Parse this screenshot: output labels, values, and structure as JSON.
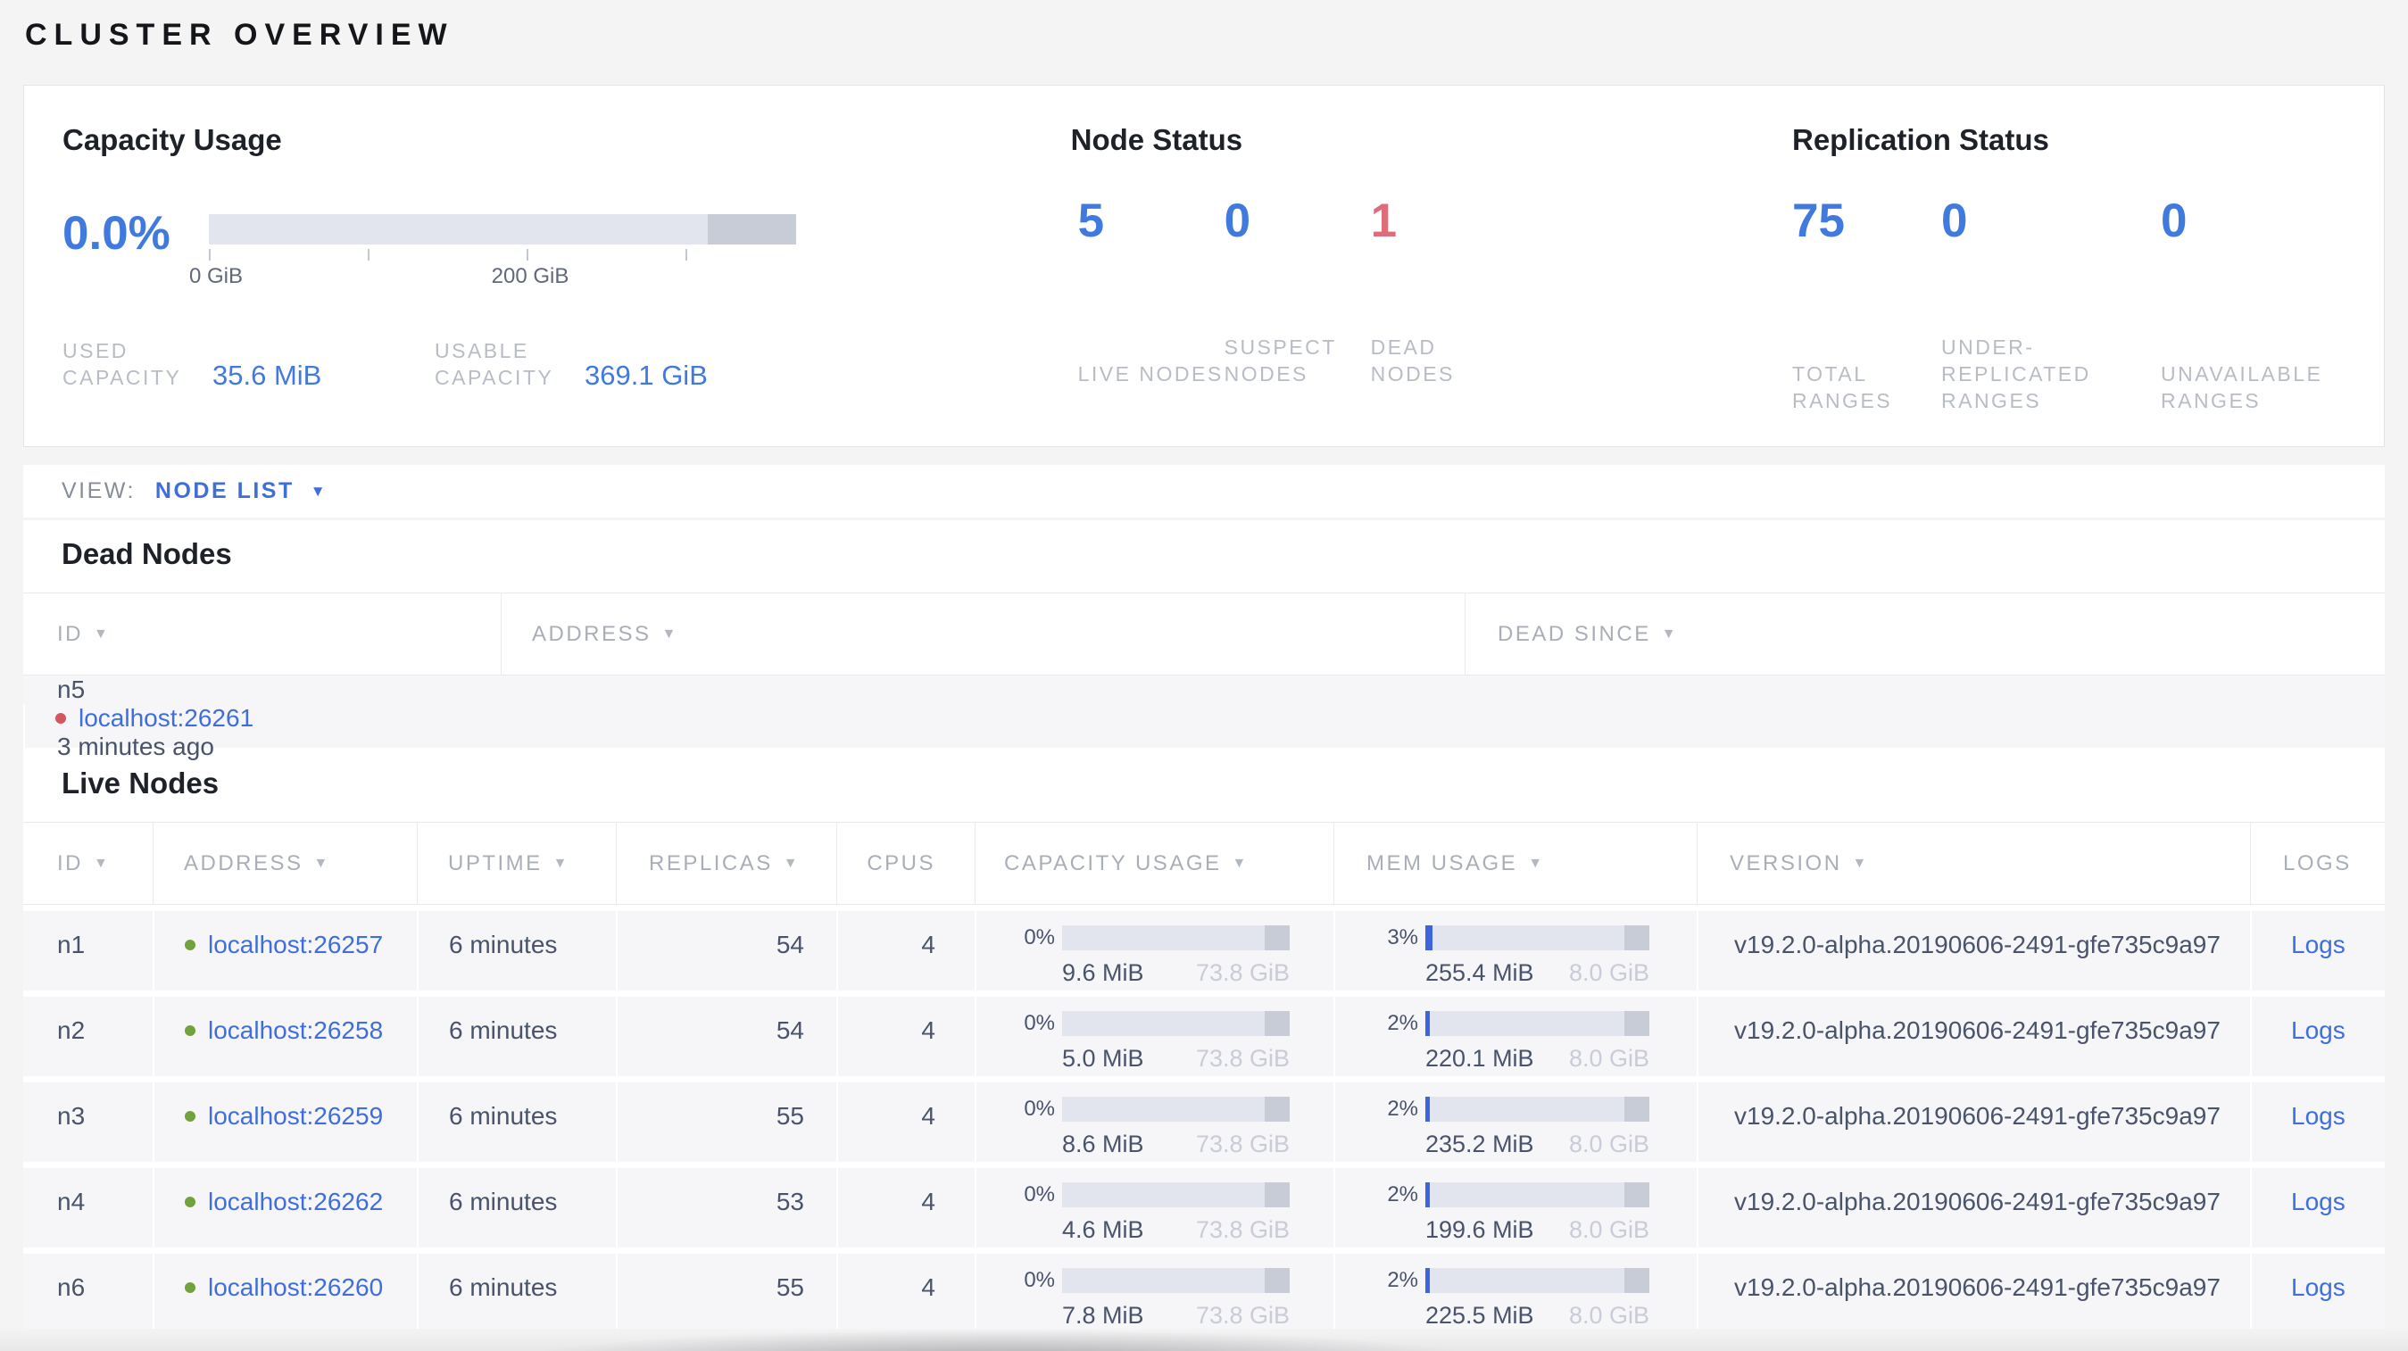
{
  "page_title": "CLUSTER OVERVIEW",
  "icons": {
    "sort_desc": "▼",
    "dropdown_caret": "▼"
  },
  "colors": {
    "accent_blue": "#407ade",
    "link_blue": "#3f6edb",
    "dead_red": "#df6d79",
    "live_green": "#71a33c",
    "bar_fill_blue": "#3d63de",
    "bar_track": "#e3e5ee",
    "bar_dark_segment": "#c7ccd7"
  },
  "summary": {
    "capacity": {
      "title": "Capacity Usage",
      "percent": "0.0%",
      "axis_labels": {
        "start": "0 GiB",
        "mid": "200 GiB"
      },
      "stats": [
        {
          "label": "USED CAPACITY",
          "value": "35.6 MiB"
        },
        {
          "label": "USABLE CAPACITY",
          "value": "369.1 GiB"
        }
      ]
    },
    "node_status": {
      "title": "Node Status",
      "stats": [
        {
          "value": "5",
          "label": "LIVE NODES"
        },
        {
          "value": "0",
          "label": "SUSPECT NODES"
        },
        {
          "value": "1",
          "label": "DEAD NODES"
        }
      ]
    },
    "replication_status": {
      "title": "Replication Status",
      "stats": [
        {
          "value": "75",
          "label": "TOTAL RANGES"
        },
        {
          "value": "0",
          "label": "UNDER-REPLICATED RANGES"
        },
        {
          "value": "0",
          "label": "UNAVAILABLE RANGES"
        }
      ]
    }
  },
  "view_bar": {
    "label": "VIEW:",
    "selected": "NODE LIST"
  },
  "dead_nodes": {
    "heading": "Dead Nodes",
    "columns": [
      {
        "label": "ID"
      },
      {
        "label": "ADDRESS"
      },
      {
        "label": "DEAD SINCE"
      }
    ],
    "rows": [
      {
        "id": "n5",
        "address": "localhost:26261",
        "dead_since": "3 minutes ago"
      }
    ]
  },
  "live_nodes": {
    "heading": "Live Nodes",
    "columns": [
      {
        "label": "ID"
      },
      {
        "label": "ADDRESS"
      },
      {
        "label": "UPTIME"
      },
      {
        "label": "REPLICAS"
      },
      {
        "label": "CPUS"
      },
      {
        "label": "CAPACITY USAGE"
      },
      {
        "label": "MEM USAGE"
      },
      {
        "label": "VERSION"
      },
      {
        "label": "LOGS"
      }
    ],
    "rows": [
      {
        "id": "n1",
        "address": "localhost:26257",
        "uptime": "6 minutes",
        "replicas": "54",
        "cpus": "4",
        "capacity": {
          "percent": "0%",
          "used": "9.6 MiB",
          "total": "73.8 GiB"
        },
        "mem": {
          "percent": "3%",
          "used": "255.4 MiB",
          "total": "8.0 GiB"
        },
        "version": "v19.2.0-alpha.20190606-2491-gfe735c9a97",
        "logs": "Logs"
      },
      {
        "id": "n2",
        "address": "localhost:26258",
        "uptime": "6 minutes",
        "replicas": "54",
        "cpus": "4",
        "capacity": {
          "percent": "0%",
          "used": "5.0 MiB",
          "total": "73.8 GiB"
        },
        "mem": {
          "percent": "2%",
          "used": "220.1 MiB",
          "total": "8.0 GiB"
        },
        "version": "v19.2.0-alpha.20190606-2491-gfe735c9a97",
        "logs": "Logs"
      },
      {
        "id": "n3",
        "address": "localhost:26259",
        "uptime": "6 minutes",
        "replicas": "55",
        "cpus": "4",
        "capacity": {
          "percent": "0%",
          "used": "8.6 MiB",
          "total": "73.8 GiB"
        },
        "mem": {
          "percent": "2%",
          "used": "235.2 MiB",
          "total": "8.0 GiB"
        },
        "version": "v19.2.0-alpha.20190606-2491-gfe735c9a97",
        "logs": "Logs"
      },
      {
        "id": "n4",
        "address": "localhost:26262",
        "uptime": "6 minutes",
        "replicas": "53",
        "cpus": "4",
        "capacity": {
          "percent": "0%",
          "used": "4.6 MiB",
          "total": "73.8 GiB"
        },
        "mem": {
          "percent": "2%",
          "used": "199.6 MiB",
          "total": "8.0 GiB"
        },
        "version": "v19.2.0-alpha.20190606-2491-gfe735c9a97",
        "logs": "Logs"
      },
      {
        "id": "n6",
        "address": "localhost:26260",
        "uptime": "6 minutes",
        "replicas": "55",
        "cpus": "4",
        "capacity": {
          "percent": "0%",
          "used": "7.8 MiB",
          "total": "73.8 GiB"
        },
        "mem": {
          "percent": "2%",
          "used": "225.5 MiB",
          "total": "8.0 GiB"
        },
        "version": "v19.2.0-alpha.20190606-2491-gfe735c9a97",
        "logs": "Logs"
      }
    ]
  }
}
